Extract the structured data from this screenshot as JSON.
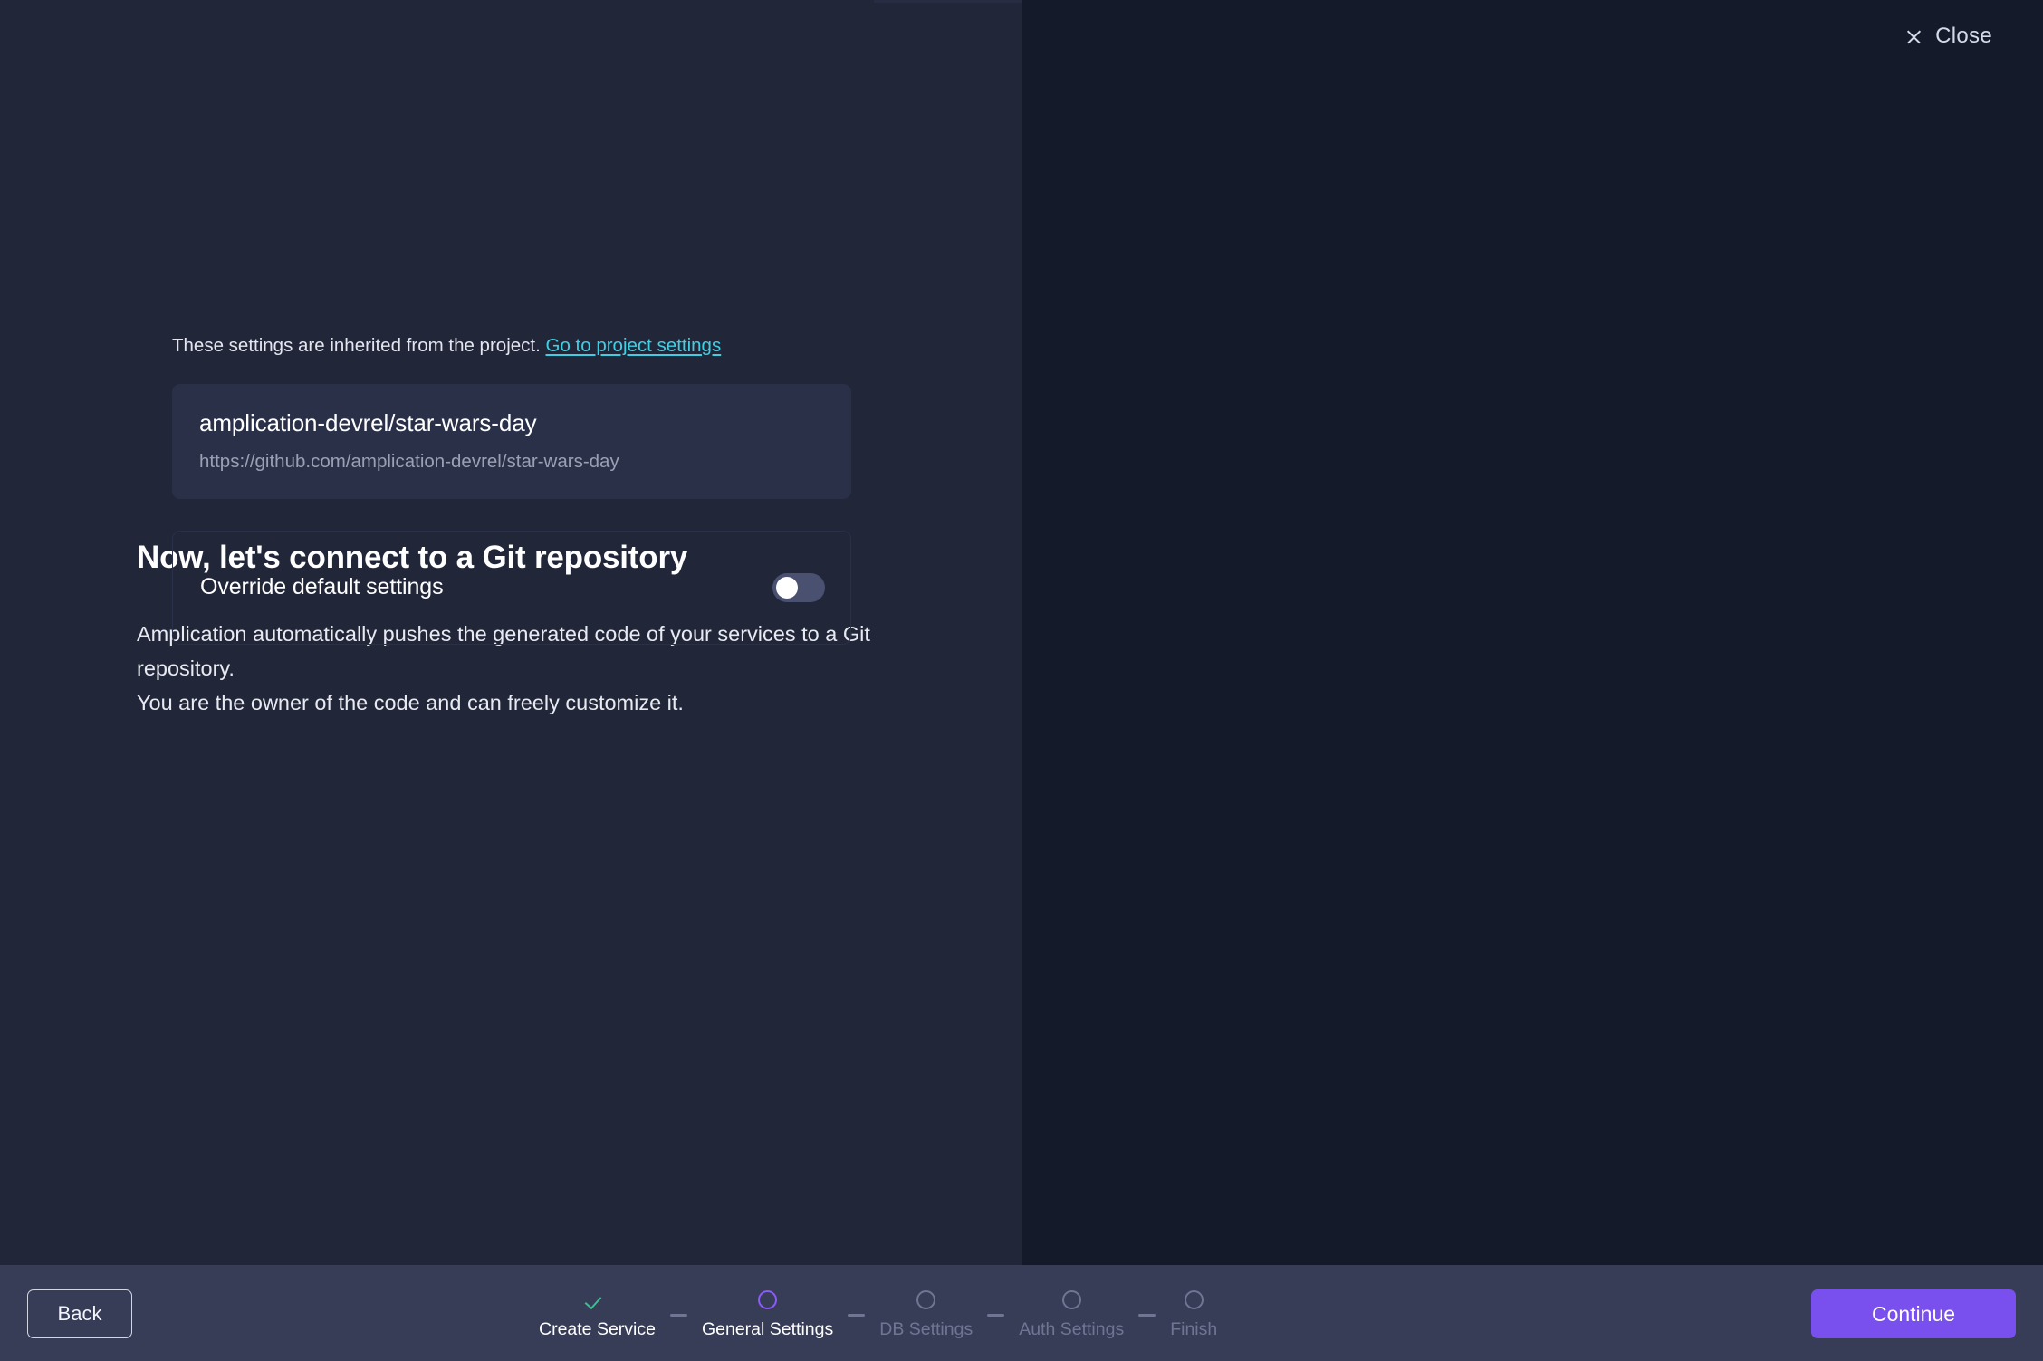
{
  "header": {
    "close_label": "Close",
    "close_icon": "close-icon"
  },
  "left": {
    "title": "Now, let's connect to a Git repository",
    "description": "Amplication automatically pushes the generated code of your services to a Git repository.\nYou are the owner of the code and can freely customize it."
  },
  "settings": {
    "inherited_note": "These settings are inherited from the project.",
    "project_settings_link": "Go to project settings",
    "repository": {
      "name": "amplication-devrel/star-wars-day",
      "url": "https://github.com/amplication-devrel/star-wars-day"
    },
    "override": {
      "label": "Override default settings",
      "toggle_state": "off"
    }
  },
  "footer": {
    "back_label": "Back",
    "continue_label": "Continue",
    "steps": [
      {
        "label": "Create Service",
        "state": "completed"
      },
      {
        "label": "General Settings",
        "state": "active"
      },
      {
        "label": "DB Settings",
        "state": "upcoming"
      },
      {
        "label": "Auth Settings",
        "state": "upcoming"
      },
      {
        "label": "Finish",
        "state": "upcoming"
      }
    ]
  },
  "colors": {
    "left_panel_bg": "#222639",
    "right_panel_bg": "#151a2b",
    "footer_bg": "#383d57",
    "accent_purple": "#7950ed",
    "step_active": "#8b5cf6",
    "step_complete": "#31c48d",
    "link_cyan": "#3ecfe3",
    "card_bg": "#2b3049",
    "toggle_track": "#4a5070"
  }
}
